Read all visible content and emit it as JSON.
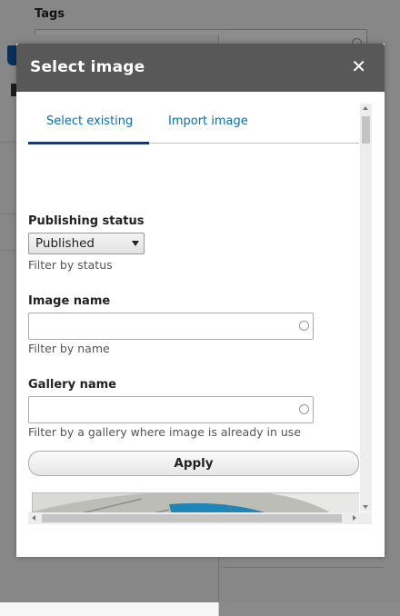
{
  "background": {
    "tags_label": "Tags"
  },
  "dialog": {
    "title": "Select image",
    "close_glyph": "✕",
    "tabs": [
      {
        "label": "Select existing",
        "active": true
      },
      {
        "label": "Import image",
        "active": false
      }
    ],
    "publishing_status": {
      "label": "Publishing status",
      "selected": "Published",
      "help": "Filter by status"
    },
    "image_name": {
      "label": "Image name",
      "value": "",
      "help": "Filter by name"
    },
    "gallery_name": {
      "label": "Gallery name",
      "value": "",
      "help": "Filter by a gallery where image is already in use"
    },
    "apply_label": "Apply"
  },
  "colors": {
    "title_bar": "#585858",
    "link": "#0a6ea8",
    "active_tab_underline": "#1a3a6b"
  }
}
